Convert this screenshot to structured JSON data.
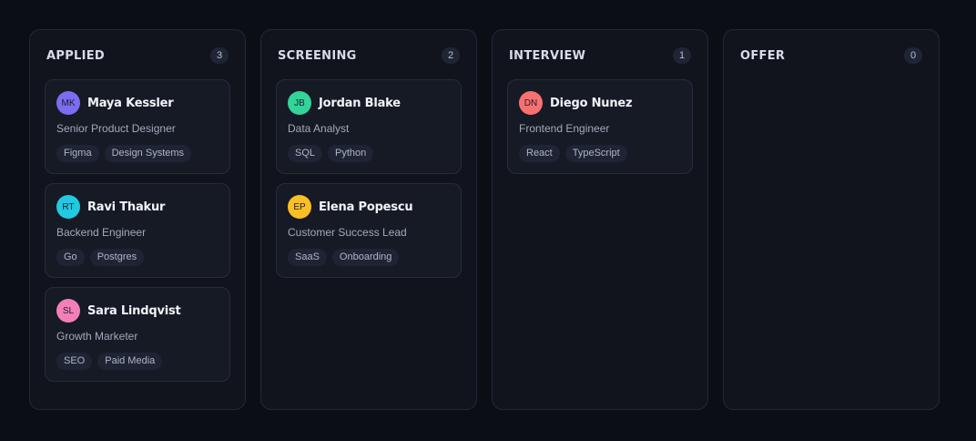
{
  "columns": [
    {
      "title": "APPLIED",
      "count": "3",
      "cards": [
        {
          "initials": "MK",
          "name": "Maya Kessler",
          "role": "Senior Product Designer",
          "avatar_color": "#7c6cf0",
          "tags": [
            "Figma",
            "Design Systems"
          ]
        },
        {
          "initials": "RT",
          "name": "Ravi Thakur",
          "role": "Backend Engineer",
          "avatar_color": "#22c9e0",
          "tags": [
            "Go",
            "Postgres"
          ]
        },
        {
          "initials": "SL",
          "name": "Sara Lindqvist",
          "role": "Growth Marketer",
          "avatar_color": "#f17fb8",
          "tags": [
            "SEO",
            "Paid Media"
          ]
        }
      ]
    },
    {
      "title": "SCREENING",
      "count": "2",
      "cards": [
        {
          "initials": "JB",
          "name": "Jordan Blake",
          "role": "Data Analyst",
          "avatar_color": "#34d399",
          "tags": [
            "SQL",
            "Python"
          ]
        },
        {
          "initials": "EP",
          "name": "Elena Popescu",
          "role": "Customer Success Lead",
          "avatar_color": "#fbbf24",
          "tags": [
            "SaaS",
            "Onboarding"
          ]
        }
      ]
    },
    {
      "title": "INTERVIEW",
      "count": "1",
      "cards": [
        {
          "initials": "DN",
          "name": "Diego Nunez",
          "role": "Frontend Engineer",
          "avatar_color": "#f87171",
          "tags": [
            "React",
            "TypeScript"
          ]
        }
      ]
    },
    {
      "title": "OFFER",
      "count": "0",
      "cards": []
    }
  ]
}
